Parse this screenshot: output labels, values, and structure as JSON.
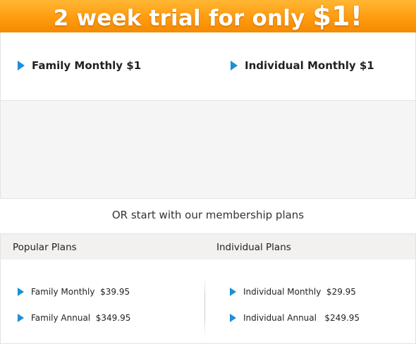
{
  "banner": {
    "title": "2 week trial for only ",
    "price": "$1!",
    "colors": {
      "start": "#ffb733",
      "end": "#f58a00",
      "text": "#ffffff"
    }
  },
  "trial_options": [
    {
      "label": "Family Monthly $1",
      "icon": "play-triangle-icon"
    },
    {
      "label": "Individual Monthly $1",
      "icon": "play-triangle-icon"
    }
  ],
  "or_text": "OR start with our membership plans",
  "plans": {
    "popular": {
      "title": "Popular Plans",
      "items": [
        {
          "label": "Family Monthly  $39.95"
        },
        {
          "label": "Family Annual  $349.95"
        }
      ]
    },
    "individual": {
      "title": "Individual Plans",
      "items": [
        {
          "label": "Individual Monthly  $29.95"
        },
        {
          "label": "Individual Annual   $249.95"
        }
      ]
    }
  },
  "accent_color": "#1f8fd6"
}
